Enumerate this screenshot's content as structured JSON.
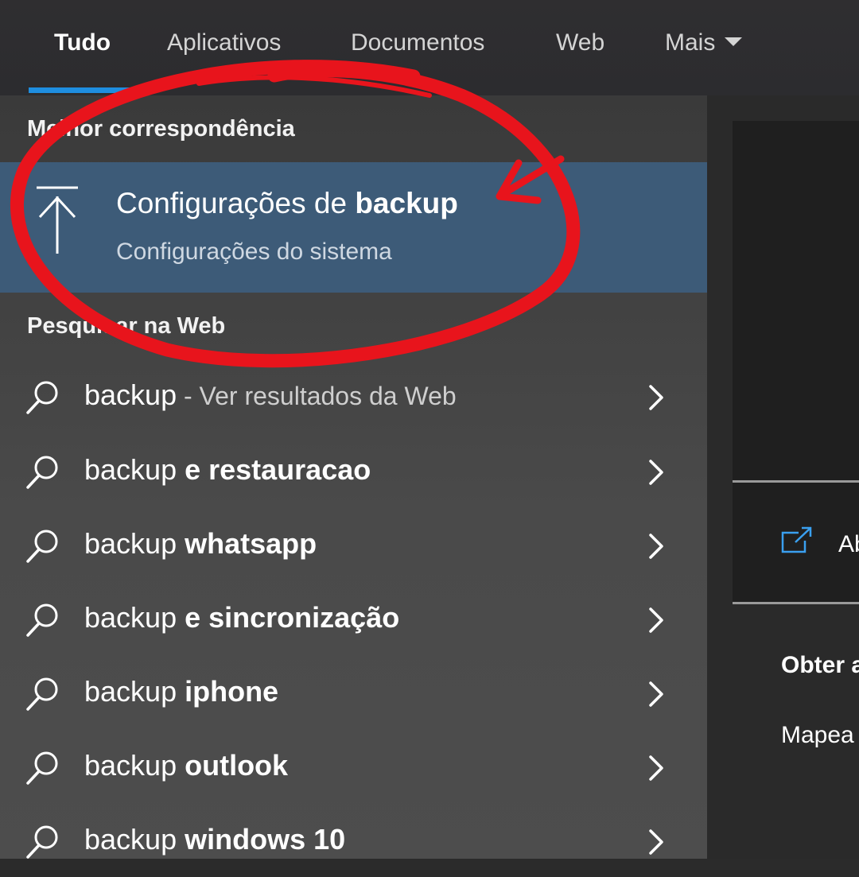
{
  "tabs": [
    {
      "label": "Tudo",
      "active": true
    },
    {
      "label": "Aplicativos",
      "active": false
    },
    {
      "label": "Documentos",
      "active": false
    },
    {
      "label": "Web",
      "active": false
    },
    {
      "label": "Mais",
      "active": false
    }
  ],
  "best_match": {
    "heading": "Melhor correspondência",
    "title_prefix": "Configurações de ",
    "title_bold": "backup",
    "subtitle": "Configurações do sistema",
    "icon": "backup-upload-icon"
  },
  "web_search": {
    "heading": "Pesquisar na Web",
    "items": [
      {
        "query": "backup",
        "rest": "",
        "hint": " - Ver resultados da Web"
      },
      {
        "query": "backup",
        "rest": " e restauracao",
        "hint": ""
      },
      {
        "query": "backup",
        "rest": " whatsapp",
        "hint": ""
      },
      {
        "query": "backup",
        "rest": " e sincronização",
        "hint": ""
      },
      {
        "query": "backup",
        "rest": " iphone",
        "hint": ""
      },
      {
        "query": "backup",
        "rest": " outlook",
        "hint": ""
      },
      {
        "query": "backup",
        "rest": " windows 10",
        "hint": ""
      }
    ]
  },
  "preview": {
    "open_label": "Ab",
    "heading": "Obter a",
    "item": "Mapea"
  },
  "colors": {
    "accent": "#1e8ee0",
    "selected_bg": "#3d5b78",
    "annotation": "#e8141c"
  },
  "icons": [
    "search-icon",
    "chevron-right-icon",
    "open-external-icon",
    "caret-down-icon"
  ]
}
